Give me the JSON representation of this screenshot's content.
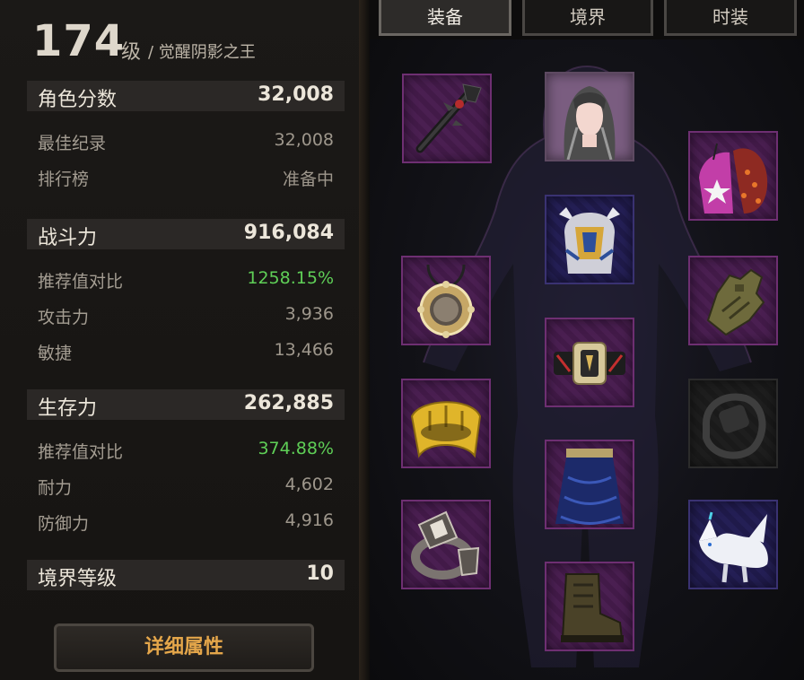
{
  "header": {
    "level": "174",
    "level_unit": "级",
    "title": "/ 觉醒阴影之王"
  },
  "stats": {
    "score": {
      "label": "角色分数",
      "value": "32,008"
    },
    "best_record": {
      "label": "最佳纪录",
      "value": "32,008"
    },
    "ranking": {
      "label": "排行榜",
      "value": "准备中"
    },
    "combat": {
      "label": "战斗力",
      "value": "916,084"
    },
    "combat_ratio": {
      "label": "推荐值对比",
      "value": "1258.15%"
    },
    "attack": {
      "label": "攻击力",
      "value": "3,936"
    },
    "agility": {
      "label": "敏捷",
      "value": "13,466"
    },
    "survival": {
      "label": "生存力",
      "value": "262,885"
    },
    "survival_ratio": {
      "label": "推荐值对比",
      "value": "374.88%"
    },
    "endurance": {
      "label": "耐力",
      "value": "4,602"
    },
    "defense": {
      "label": "防御力",
      "value": "4,916"
    },
    "realm_level": {
      "label": "境界等级",
      "value": "10"
    }
  },
  "detail_button": "详细属性",
  "tabs": [
    "装备",
    "境界",
    "时装"
  ],
  "active_tab": 0,
  "colors": {
    "green_value": "#5fcf57",
    "button_text": "#e4a64a",
    "legendary_slot": "#421a48",
    "epic_slot": "#1f1a4a"
  },
  "equipment_slots": [
    {
      "slot": "weapon",
      "icon": "dark-spiked-staff-icon",
      "rarity": "legendary"
    },
    {
      "slot": "head",
      "icon": "long-hair-face-icon",
      "rarity": "face"
    },
    {
      "slot": "shoulder",
      "icon": "pink-star-costume-icon",
      "rarity": "legendary"
    },
    {
      "slot": "chest",
      "icon": "winged-chest-armor-icon",
      "rarity": "epic"
    },
    {
      "slot": "necklace",
      "icon": "gold-compass-necklace-icon",
      "rarity": "legendary"
    },
    {
      "slot": "gloves",
      "icon": "green-glove-icon",
      "rarity": "legendary"
    },
    {
      "slot": "belt",
      "icon": "champion-belt-icon",
      "rarity": "legendary"
    },
    {
      "slot": "bracelet",
      "icon": "gold-bracelet-icon",
      "rarity": "legendary"
    },
    {
      "slot": "empty-bracelet",
      "icon": "bracelet-outline-icon",
      "rarity": "empty"
    },
    {
      "slot": "pants",
      "icon": "blue-skirt-icon",
      "rarity": "legendary"
    },
    {
      "slot": "ring",
      "icon": "silver-ring-icon",
      "rarity": "legendary"
    },
    {
      "slot": "pet",
      "icon": "white-fox-pet-icon",
      "rarity": "epic"
    },
    {
      "slot": "boots",
      "icon": "military-boot-icon",
      "rarity": "legendary"
    }
  ]
}
